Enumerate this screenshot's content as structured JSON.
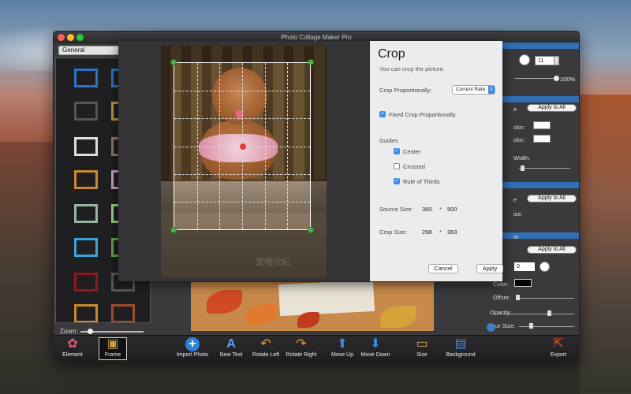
{
  "window": {
    "title": "Photo Collage Maker Pro"
  },
  "left_panel": {
    "category": "General",
    "zoom_label": "Zoom:",
    "zoom_level": 0.15
  },
  "toolbar": {
    "items": [
      {
        "label": "Element",
        "icon": "flower-icon"
      },
      {
        "label": "Frame",
        "icon": "frame-icon"
      },
      {
        "label": "Import Photo",
        "icon": "plus-circle-icon"
      },
      {
        "label": "New Text",
        "icon": "text-plus-icon"
      },
      {
        "label": "Rotate Left",
        "icon": "rotate-left-icon"
      },
      {
        "label": "Rotate Right",
        "icon": "rotate-right-icon"
      },
      {
        "label": "Move Up",
        "icon": "arrow-up-icon"
      },
      {
        "label": "Move Down",
        "icon": "arrow-down-icon"
      },
      {
        "label": "Size",
        "icon": "ruler-icon"
      },
      {
        "label": "Background",
        "icon": "background-icon"
      },
      {
        "label": "Export",
        "icon": "export-icon"
      }
    ]
  },
  "right_panel": {
    "opacity_value": "11",
    "percent": "100%",
    "apply_to_all": "Apply to All",
    "color_label_1": "olor:",
    "color_label_2": "olor:",
    "width_label": "Width:",
    "size_label": "ize:",
    "shadow_value": "0",
    "color_label": "Color:",
    "offset_label": "Offset:",
    "opacity_label": "Opacity:",
    "blur_label": "ur Size:",
    "shadow_color": "#000000"
  },
  "crop_dialog": {
    "title": "Crop",
    "subtitle": "You can crop the picture.",
    "proportion_label": "Crop Proportionally:",
    "proportion_value": "Current Rate",
    "fixed_label": "Fixed Crop Proportionally",
    "fixed_checked": true,
    "guides_label": "Guides",
    "guides": [
      {
        "label": "Center",
        "checked": true
      },
      {
        "label": "Crossed",
        "checked": false
      },
      {
        "label": "Rule of Thirds",
        "checked": true
      }
    ],
    "source_size_label": "Source Size:",
    "source_w": "360",
    "source_h": "500",
    "crop_size_label": "Crop Size:",
    "crop_w": "298",
    "crop_h": "363",
    "cancel": "Cancel",
    "apply": "Apply",
    "times": "*"
  },
  "colors": {
    "accent": "#3c8be6",
    "panel_header": "#2f6fb5",
    "handle": "#4fb54f"
  }
}
